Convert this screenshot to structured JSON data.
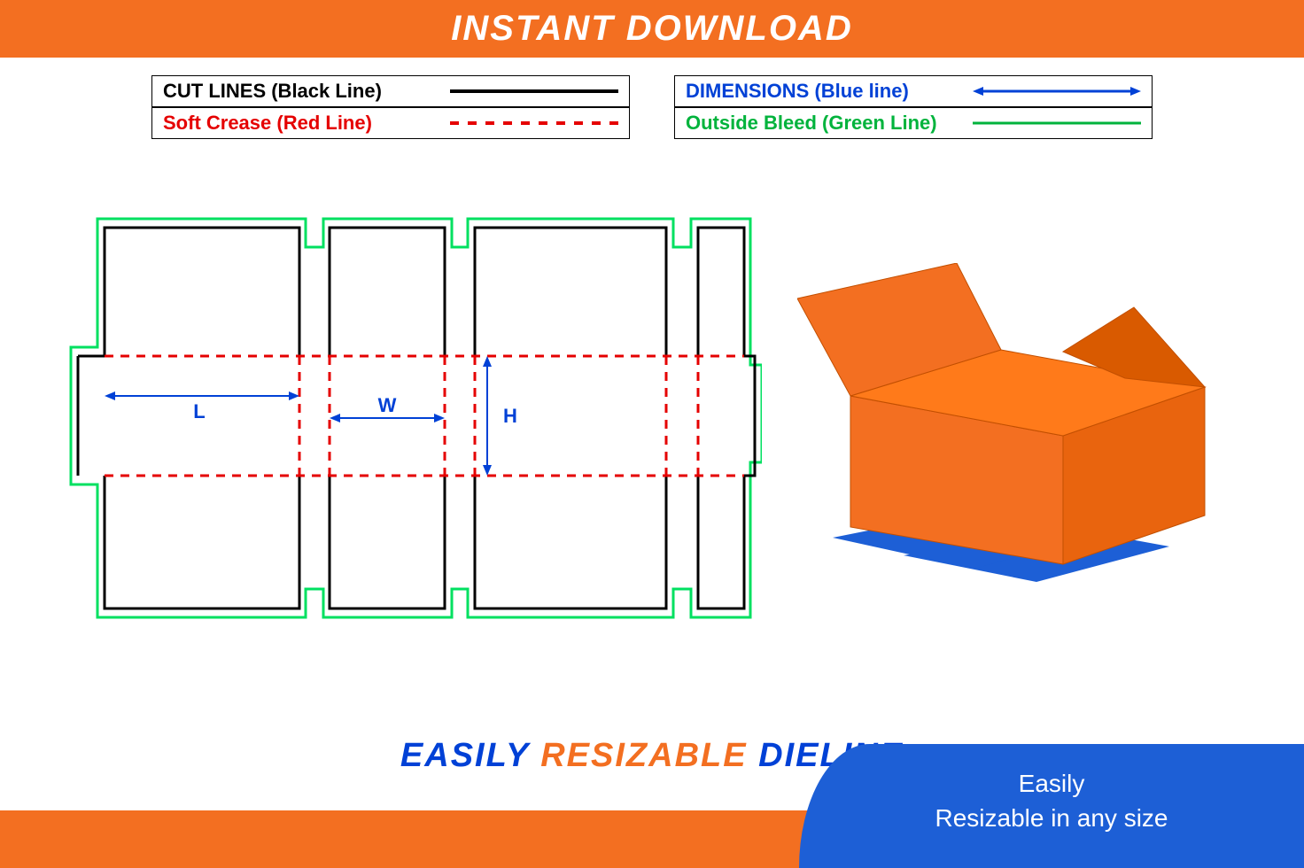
{
  "header": {
    "title": "INSTANT DOWNLOAD"
  },
  "legend": {
    "left": [
      {
        "label": "CUT LINES (Black Line)",
        "color": "black-text",
        "sample": "solid-black"
      },
      {
        "label": "Soft Crease (Red Line)",
        "color": "red-text",
        "sample": "dashed-red"
      }
    ],
    "right": [
      {
        "label": "DIMENSIONS (Blue line)",
        "color": "blue-text",
        "sample": "arrow-blue"
      },
      {
        "label": "Outside Bleed (Green Line)",
        "color": "green-text",
        "sample": "solid-green"
      }
    ]
  },
  "dieline": {
    "dims": {
      "L": "L",
      "W": "W",
      "H": "H"
    }
  },
  "footer": {
    "tagline": {
      "word1": "EASILY",
      "word2": "RESIZABLE",
      "word3": "DIELINE"
    },
    "badge": {
      "line1": "Easily",
      "line2": "Resizable in any size"
    }
  }
}
